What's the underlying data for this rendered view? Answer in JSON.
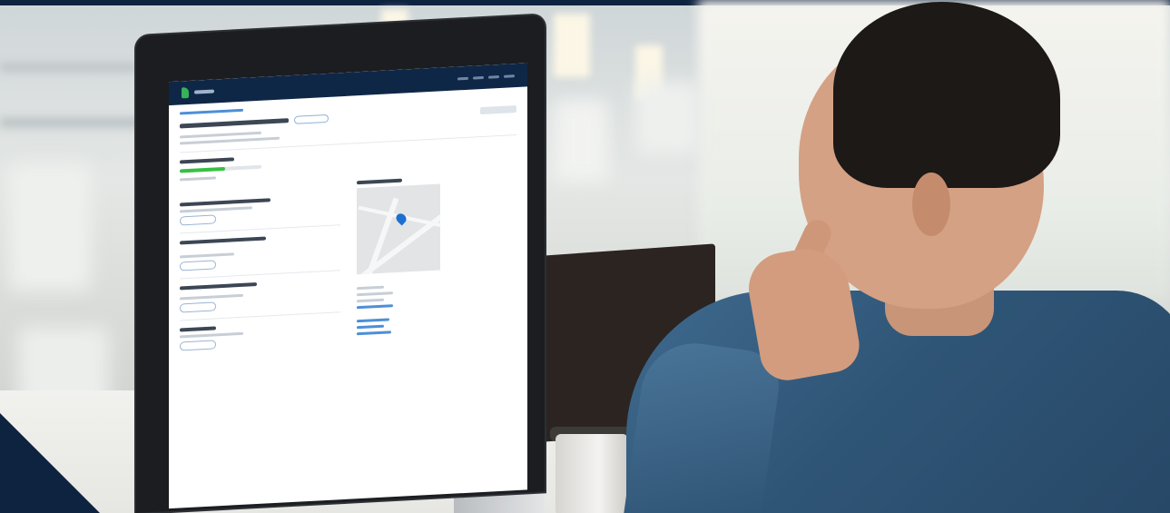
{
  "scene": {
    "description_colors": {
      "frame": "#0e2340",
      "screen_header": "#0f2747",
      "progress_green": "#37c043",
      "map_pin": "#1e6fd1",
      "shirt": "#2f5576"
    },
    "screen": {
      "progress_fraction": 0.55
    }
  }
}
